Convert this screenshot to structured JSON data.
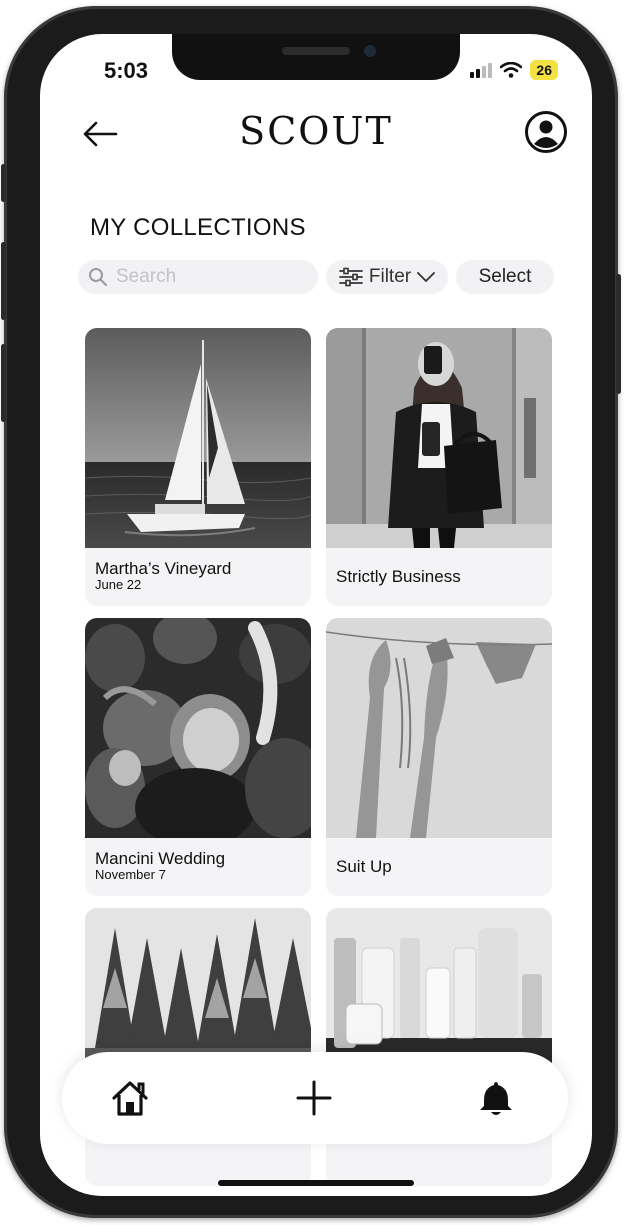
{
  "status_bar": {
    "time": "5:03",
    "battery": "26"
  },
  "header": {
    "title": "SCOUT"
  },
  "section_title": "MY COLLECTIONS",
  "search": {
    "placeholder": "Search",
    "value": ""
  },
  "filter_label": "Filter",
  "select_label": "Select",
  "collections": [
    {
      "name": "Martha’s Vineyard",
      "date": "June 22"
    },
    {
      "name": "Strictly Business",
      "date": ""
    },
    {
      "name": "Mancini Wedding",
      "date": "November 7"
    },
    {
      "name": "Suit Up",
      "date": ""
    },
    {
      "name": "",
      "date": ""
    },
    {
      "name": "",
      "date": ""
    }
  ],
  "bottom_nav": [
    "home-icon",
    "plus-icon",
    "bell-icon"
  ]
}
